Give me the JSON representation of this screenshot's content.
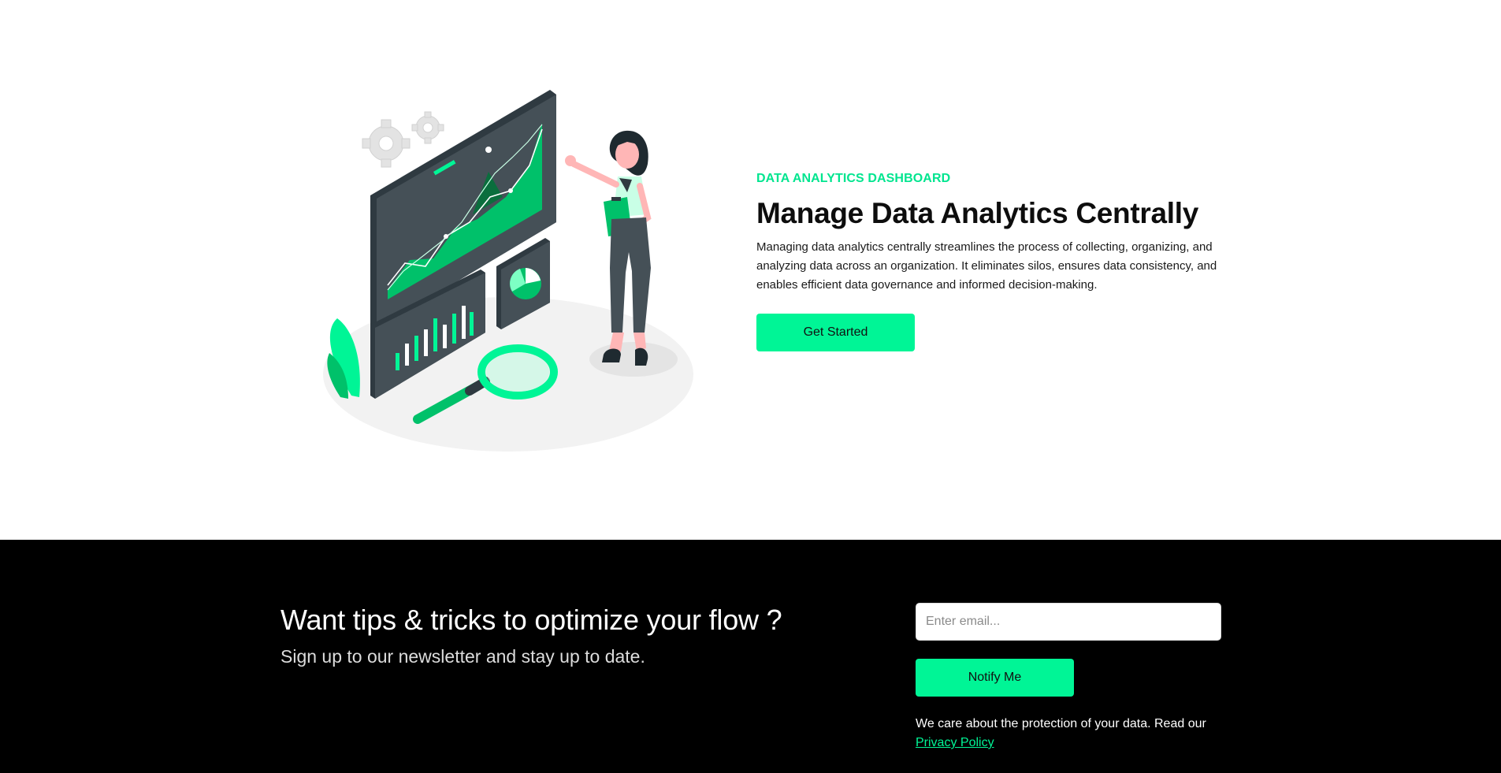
{
  "hero": {
    "eyebrow": "DATA ANALYTICS DASHBOARD",
    "title": "Manage Data Analytics Centrally",
    "description": "Managing data analytics centrally streamlines the process of collecting, organizing, and analyzing data across an organization. It eliminates silos, ensures data consistency, and enables efficient data governance and informed decision-making.",
    "cta_label": "Get Started"
  },
  "newsletter": {
    "title": "Want tips & tricks to optimize your flow ?",
    "subtitle": "Sign up to our newsletter and stay up to date.",
    "email_placeholder": "Enter email...",
    "button_label": "Notify Me",
    "privacy_text": "We care about the protection of your data. Read our",
    "privacy_link": "Privacy Policy"
  },
  "colors": {
    "accent": "#00f596",
    "accent_text": "#00e58f",
    "dark_panel": "#455057",
    "footer_bg": "#000000"
  }
}
